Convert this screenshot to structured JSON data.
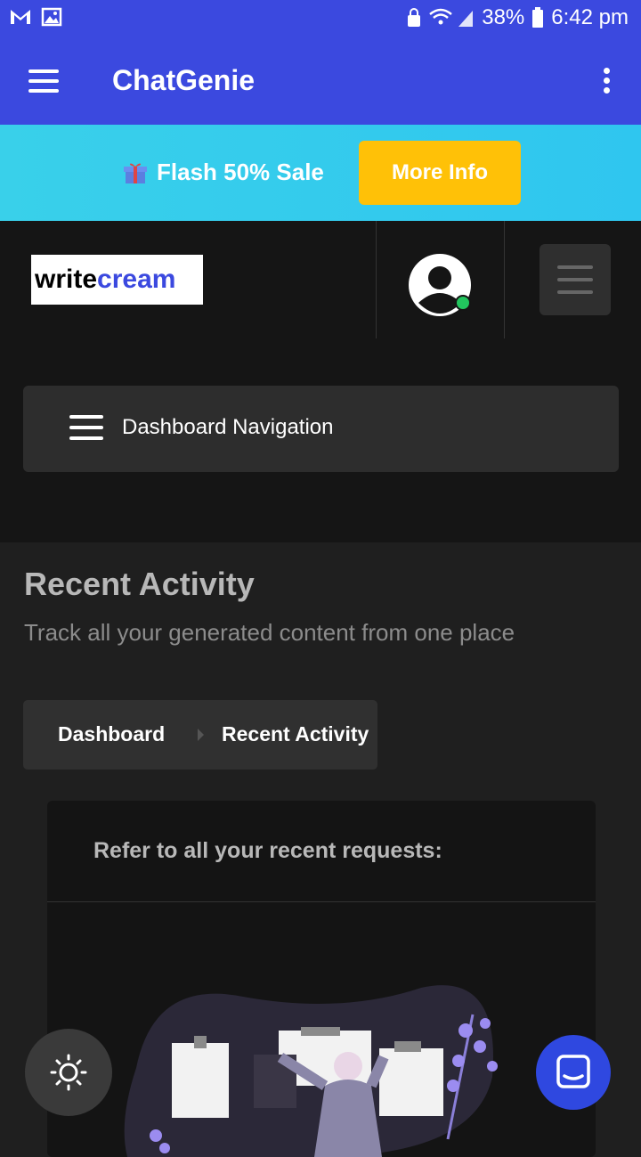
{
  "status": {
    "battery": "38%",
    "time": "6:42 pm"
  },
  "appbar": {
    "title": "ChatGenie"
  },
  "sale": {
    "text": "Flash 50% Sale",
    "button": "More Info"
  },
  "logo": {
    "part1": "write",
    "part2": "cream"
  },
  "dashboard_nav": {
    "label": "Dashboard Navigation"
  },
  "page": {
    "title": "Recent Activity",
    "subtitle": "Track all your generated content from one place"
  },
  "breadcrumb": {
    "items": [
      "Dashboard",
      "Recent Activity"
    ]
  },
  "card": {
    "header": "Refer to all your recent requests:"
  },
  "colors": {
    "brand": "#3b49df",
    "sale_bg": "#39d0ea",
    "sale_button": "#ffc107",
    "online": "#22c55e"
  }
}
